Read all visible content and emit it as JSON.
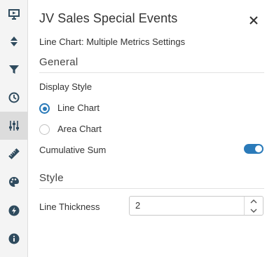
{
  "panel": {
    "title": "JV Sales Special Events",
    "subtitle": "Line Chart: Multiple Metrics Settings"
  },
  "sidebar": {
    "items": [
      {
        "icon": "presentation-icon",
        "active": false
      },
      {
        "icon": "sort-icon",
        "active": false
      },
      {
        "icon": "filter-icon",
        "active": false
      },
      {
        "icon": "clock-icon",
        "active": false
      },
      {
        "icon": "sliders-icon",
        "active": true
      },
      {
        "icon": "ruler-icon",
        "active": false
      },
      {
        "icon": "palette-icon",
        "active": false
      },
      {
        "icon": "lightning-icon",
        "active": false
      },
      {
        "icon": "info-icon",
        "active": false
      }
    ]
  },
  "general": {
    "heading": "General",
    "display_style_label": "Display Style",
    "options": [
      {
        "label": "Line Chart",
        "selected": true
      },
      {
        "label": "Area Chart",
        "selected": false
      }
    ],
    "cumulative_sum_label": "Cumulative Sum",
    "cumulative_sum_enabled": true
  },
  "style": {
    "heading": "Style",
    "line_thickness_label": "Line Thickness",
    "line_thickness_value": "2"
  },
  "colors": {
    "accent": "#2a7ab9",
    "icon": "#2f4b5e",
    "rail_background": "#f4f4f4",
    "rail_active": "#dcdcdc"
  }
}
